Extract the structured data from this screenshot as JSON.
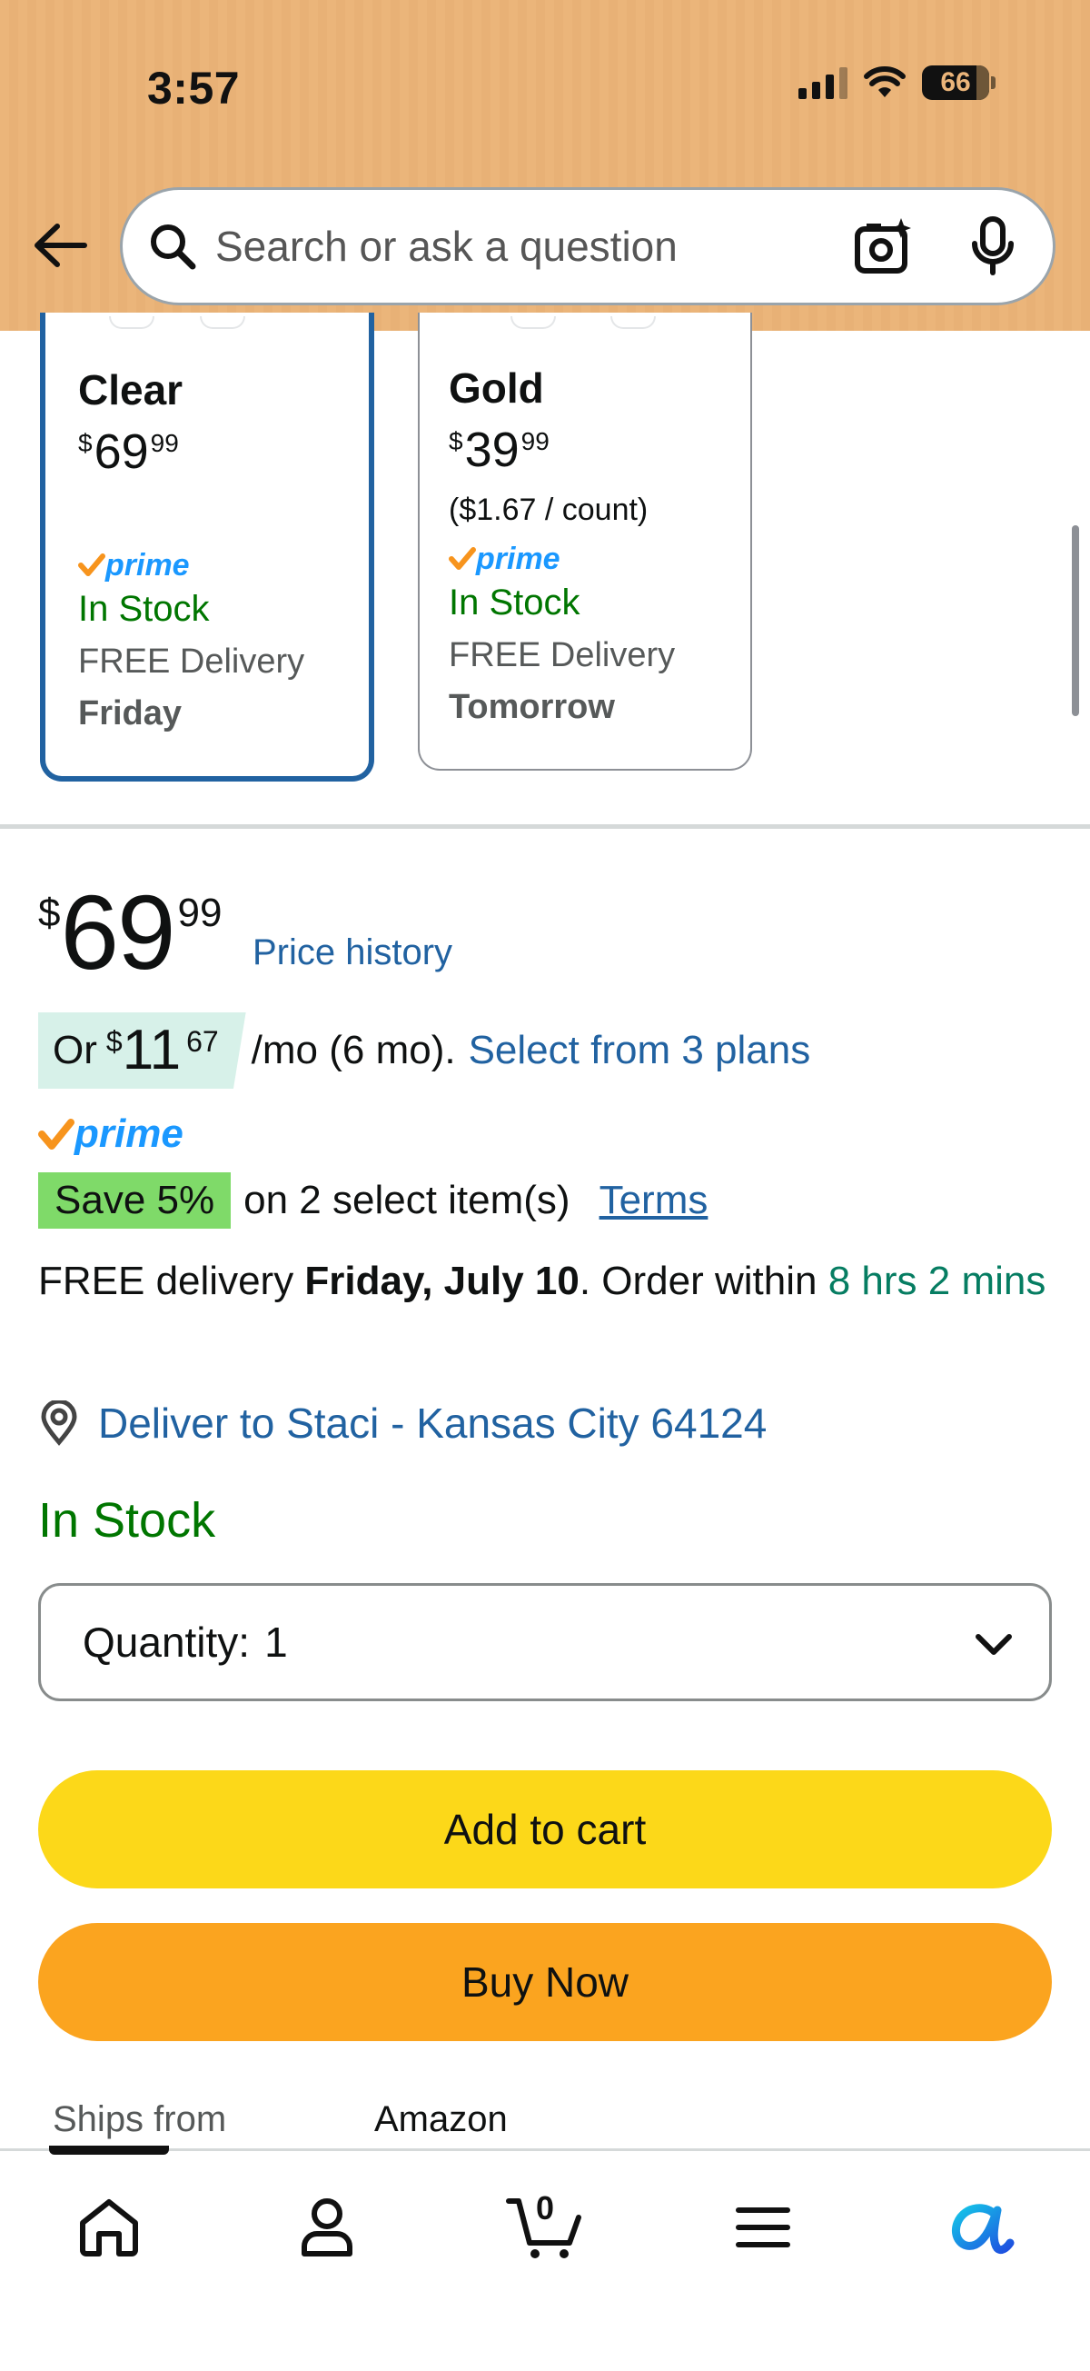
{
  "status_bar": {
    "time": "3:57",
    "battery": "66"
  },
  "search": {
    "placeholder": "Search or ask a question"
  },
  "variants": [
    {
      "name": "Clear",
      "price_currency": "$",
      "price_whole": "69",
      "price_fraction": "99",
      "unit_price": "",
      "prime": "prime",
      "stock": "In Stock",
      "delivery": "FREE Delivery",
      "delivery_day": "Friday",
      "selected": true
    },
    {
      "name": "Gold",
      "price_currency": "$",
      "price_whole": "39",
      "price_fraction": "99",
      "unit_price": "($1.67 / count)",
      "prime": "prime",
      "stock": "In Stock",
      "delivery": "FREE Delivery",
      "delivery_day": "Tomorrow",
      "selected": false
    }
  ],
  "price": {
    "currency": "$",
    "whole": "69",
    "fraction": "99",
    "history_link": "Price history"
  },
  "installment": {
    "prefix": "Or",
    "currency": "$",
    "whole": "11",
    "fraction": "67",
    "term": "/mo (6 mo).",
    "link": "Select from 3 plans"
  },
  "prime_badge": "prime",
  "save": {
    "badge": "Save 5%",
    "text": "on 2 select item(s)",
    "terms": "Terms"
  },
  "delivery": {
    "prefix": "FREE delivery",
    "date": "Friday, July 10",
    "order_within": ". Order within",
    "countdown": "8 hrs 2 mins"
  },
  "deliver_to": "Deliver to Staci - Kansas City 64124",
  "availability": "In Stock",
  "quantity": {
    "label": "Quantity:",
    "value": "1"
  },
  "buttons": {
    "add_to_cart": "Add to cart",
    "buy_now": "Buy Now"
  },
  "ships_from": {
    "label": "Ships from",
    "value": "Amazon"
  },
  "tabbar": {
    "items": [
      {
        "name": "home",
        "icon": "home-icon"
      },
      {
        "name": "account",
        "icon": "person-icon"
      },
      {
        "name": "cart",
        "icon": "cart-icon",
        "count": "0"
      },
      {
        "name": "menu",
        "icon": "hamburger-icon"
      },
      {
        "name": "rufus",
        "icon": "rufus-ai-icon"
      }
    ]
  },
  "colors": {
    "header": "#EBB57A",
    "link": "#2162A1",
    "in_stock": "#007600",
    "add_to_cart": "#FCD819",
    "buy_now": "#FBA41F",
    "save_badge": "#7FDA69",
    "installment_bg": "#D7F1E9",
    "prime_blue": "#1A98FF",
    "prime_check": "#F7941D"
  }
}
